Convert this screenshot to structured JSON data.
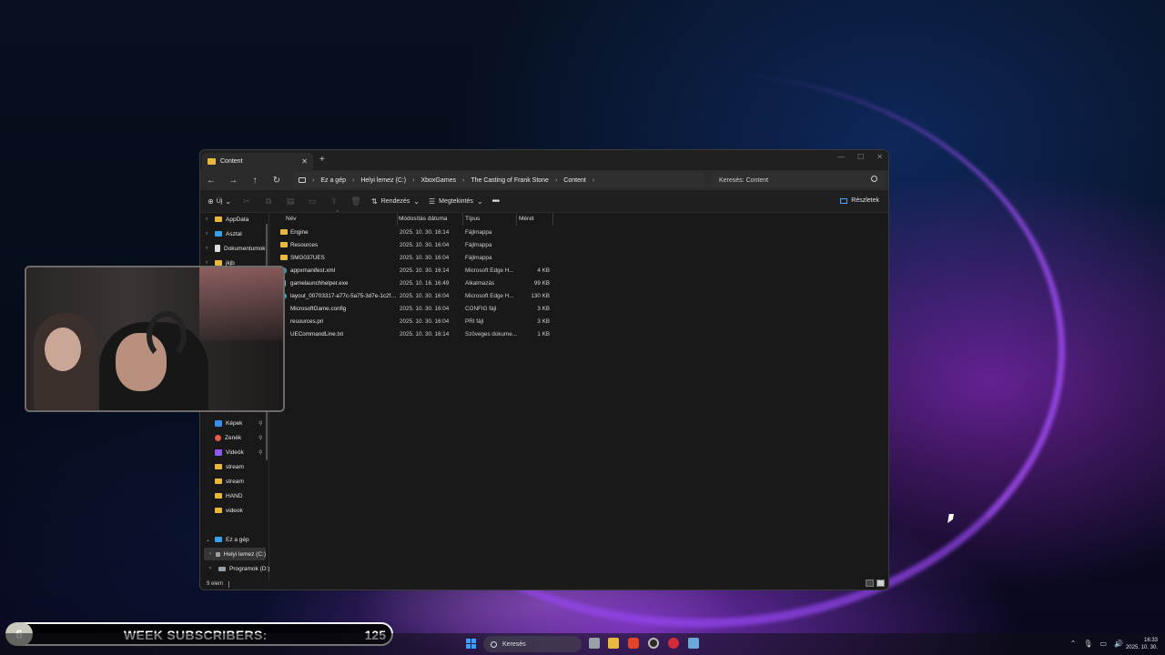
{
  "window": {
    "tab_title": "Content",
    "breadcrumb": [
      "Ez a gép",
      "Helyi lemez (C:)",
      "XboxGames",
      "The Casting of Frank Stone",
      "Content"
    ],
    "search_placeholder": "Keresés: Content"
  },
  "toolbar": {
    "new_label": "Új",
    "sort_label": "Rendezés",
    "view_label": "Megtekintés",
    "details_label": "Részletek"
  },
  "sidebar": {
    "top_items": [
      "AppData",
      "Asztal",
      "Dokumentumok",
      "jkjb"
    ],
    "quick_items": [
      "Képek",
      "Zenék",
      "Videók",
      "stream",
      "stream",
      "HAND",
      "videok"
    ],
    "this_pc_label": "Ez a gép",
    "drives": [
      "Helyi lemez (C:)",
      "Programok (D:)"
    ]
  },
  "columns": {
    "name": "Név",
    "date": "Módosítás dátuma",
    "type": "Típus",
    "size": "Méret"
  },
  "files": [
    {
      "name": "Engine",
      "date": "2025. 10. 30. 16:14",
      "type": "Fájlmappa",
      "size": "",
      "icon": "folder-icon"
    },
    {
      "name": "Resources",
      "date": "2025. 10. 30. 16:04",
      "type": "Fájlmappa",
      "size": "",
      "icon": "folder-icon"
    },
    {
      "name": "SMG037UES",
      "date": "2025. 10. 30. 16:04",
      "type": "Fájlmappa",
      "size": "",
      "icon": "folder-icon"
    },
    {
      "name": "appxmanifest.xml",
      "date": "2025. 10. 30. 16:14",
      "type": "Microsoft Edge H...",
      "size": "4 KB",
      "icon": "edge-icon"
    },
    {
      "name": "gamelaunchhelper.exe",
      "date": "2025. 10. 16. 16:49",
      "type": "Alkalmazás",
      "size": "99 KB",
      "icon": "exe-icon"
    },
    {
      "name": "layout_00703317-a77c-5a75-3d7e-1c2f98f...",
      "date": "2025. 10. 30. 16:04",
      "type": "Microsoft Edge H...",
      "size": "130 KB",
      "icon": "edge-icon"
    },
    {
      "name": "MicrosoftGame.config",
      "date": "2025. 10. 30. 16:04",
      "type": "CONFIG fájl",
      "size": "3 KB",
      "icon": "file-icon"
    },
    {
      "name": "resources.pri",
      "date": "2025. 10. 30. 16:04",
      "type": "PRI fájl",
      "size": "3 KB",
      "icon": "file-icon"
    },
    {
      "name": "UECommandLine.txt",
      "date": "2025. 10. 30. 16:14",
      "type": "Szöveges dokume...",
      "size": "1 KB",
      "icon": "file-icon"
    }
  ],
  "status": {
    "item_count": "9 elem"
  },
  "overlay": {
    "badge": "6",
    "label": "WEEK SUBSCRIBERS:",
    "count": "125"
  },
  "taskbar": {
    "search_label": "Keresés",
    "time": "16:33",
    "date": "2025. 10. 30."
  }
}
